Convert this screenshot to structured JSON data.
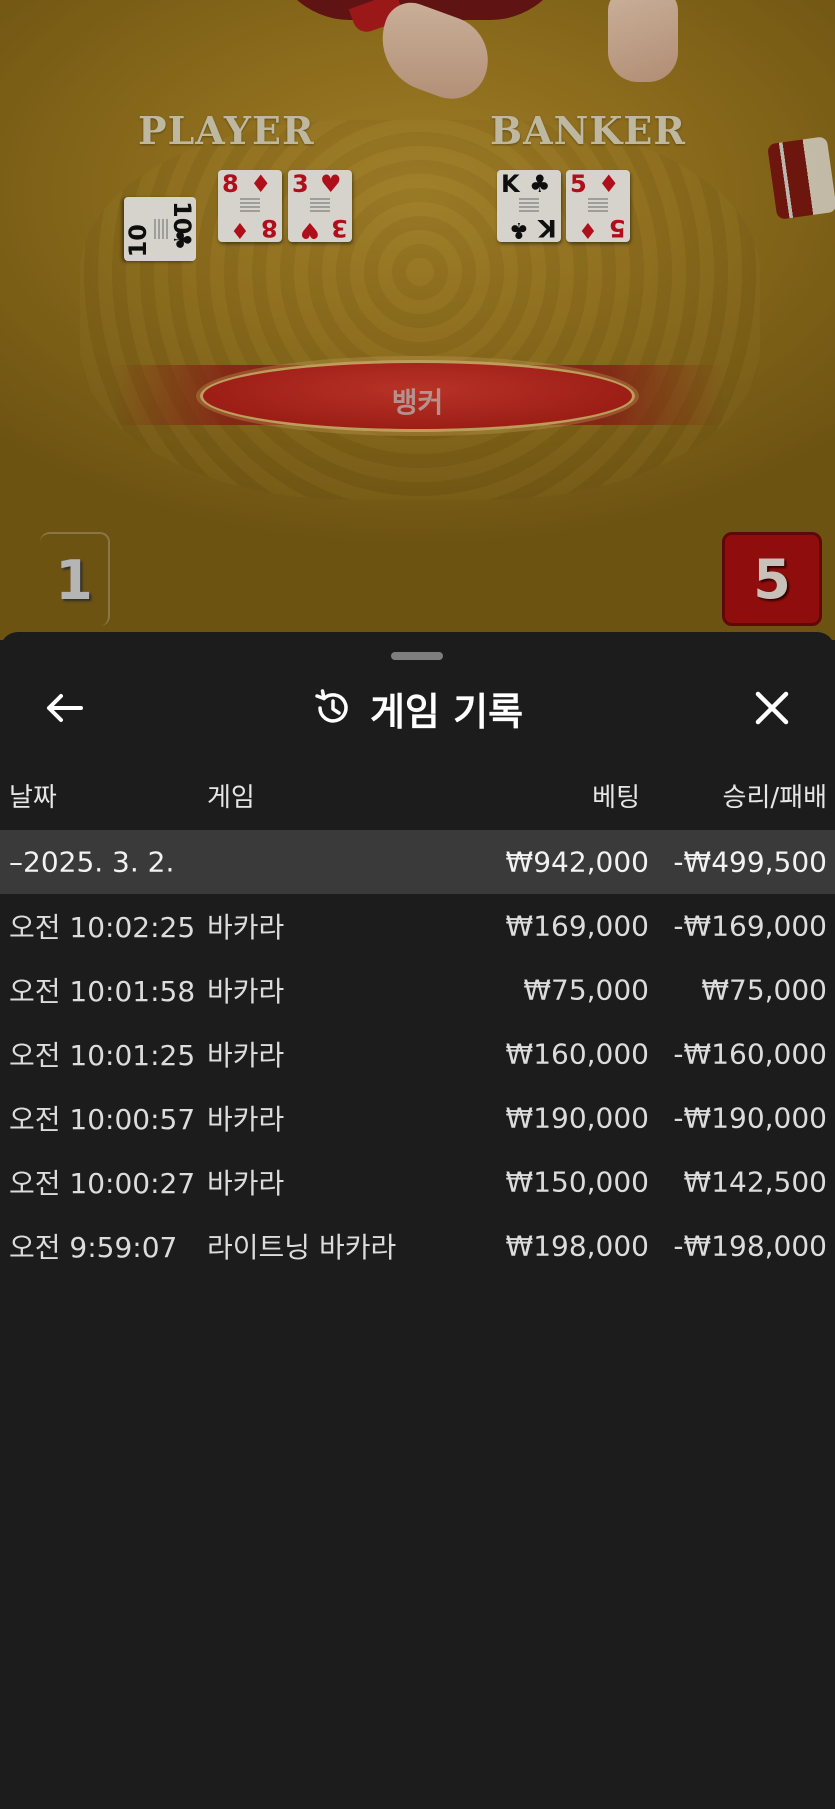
{
  "game_view": {
    "player_label": "PLAYER",
    "banker_label": "BANKER",
    "player_cards": [
      {
        "rank": "10",
        "suit": "♣",
        "color": "black"
      },
      {
        "rank": "8",
        "suit": "♦",
        "color": "red"
      },
      {
        "rank": "3",
        "suit": "♥",
        "color": "red"
      }
    ],
    "banker_cards": [
      {
        "rank": "K",
        "suit": "♣",
        "color": "black"
      },
      {
        "rank": "5",
        "suit": "♦",
        "color": "red"
      }
    ],
    "result_label": "뱅커",
    "player_score": "1",
    "banker_score": "5"
  },
  "sheet": {
    "title": "게임 기록",
    "back_icon": "arrow-left-icon",
    "history_icon": "history-icon",
    "close_icon": "close-icon"
  },
  "columns": {
    "date": "날짜",
    "game": "게임",
    "bet": "베팅",
    "result": "승리/패배"
  },
  "summary": {
    "date": "–2025. 3. 2.",
    "bet": "₩942,000",
    "result": "-₩499,500"
  },
  "rows": [
    {
      "time": "오전 10:02:25",
      "game": "바카라",
      "bet": "₩169,000",
      "result": "-₩169,000"
    },
    {
      "time": "오전 10:01:58",
      "game": "바카라",
      "bet": "₩75,000",
      "result": "₩75,000"
    },
    {
      "time": "오전 10:01:25",
      "game": "바카라",
      "bet": "₩160,000",
      "result": "-₩160,000"
    },
    {
      "time": "오전 10:00:57",
      "game": "바카라",
      "bet": "₩190,000",
      "result": "-₩190,000"
    },
    {
      "time": "오전 10:00:27",
      "game": "바카라",
      "bet": "₩150,000",
      "result": "₩142,500"
    },
    {
      "time": "오전 9:59:07",
      "game": "라이트닝 바카라",
      "bet": "₩198,000",
      "result": "-₩198,000"
    }
  ],
  "colors": {
    "sheet_bg": "#1c1c1c",
    "summary_bg": "#3a3a3a",
    "felt": "#9e7a20",
    "banker_red": "#a3110f"
  }
}
